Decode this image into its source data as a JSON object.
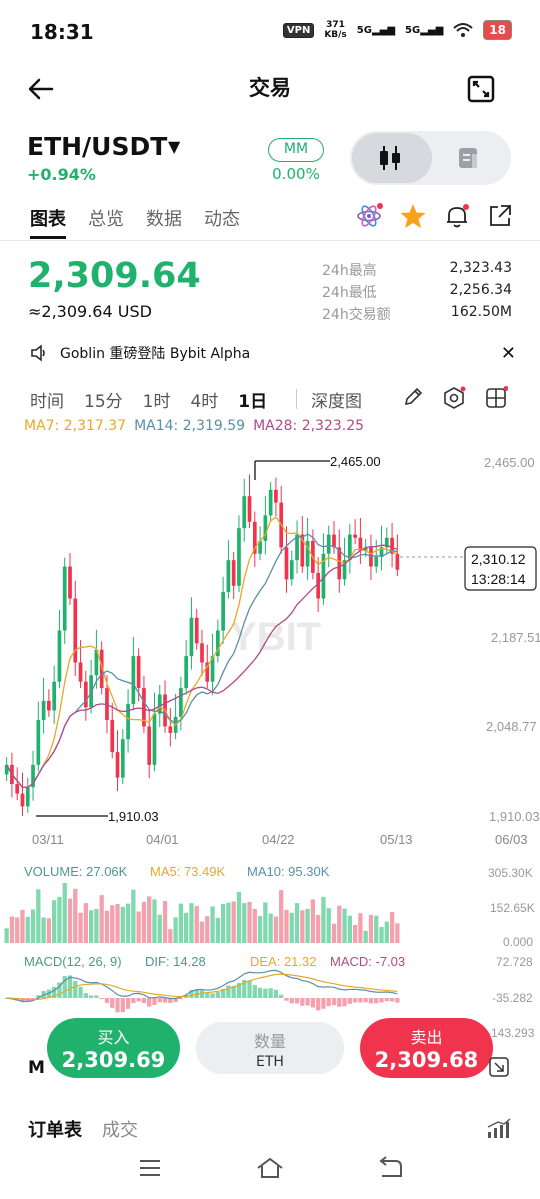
{
  "status_bar": {
    "time": "18:31",
    "vpn": "VPN",
    "speed_value": "371",
    "speed_unit": "KB/s",
    "net1": "5G",
    "net2": "5G",
    "battery": "18"
  },
  "header": {
    "title": "交易",
    "back_icon": "arrow-left-icon",
    "expand_icon": "expand-icon"
  },
  "pair": {
    "symbol": "ETH/USDT",
    "change": "+0.94%",
    "mm_label": "MM",
    "mm_value": "0.00%"
  },
  "tabs": [
    "图表",
    "总览",
    "数据",
    "动态"
  ],
  "ticker": {
    "price": "2,309.64",
    "price_usd": "≈2,309.64 USD",
    "stats": [
      {
        "label": "24h最高",
        "value": "2,323.43"
      },
      {
        "label": "24h最低",
        "value": "2,256.34"
      },
      {
        "label": "24h交易额",
        "value": "162.50M"
      }
    ]
  },
  "notice": {
    "text": "Goblin 重磅登陆 Bybit Alpha"
  },
  "intervals": {
    "items": [
      "时间",
      "15分",
      "1时",
      "4时",
      "1日"
    ],
    "active": "1日",
    "depth": "深度图"
  },
  "ma_legend": {
    "ma7": "MA7: 2,317.37",
    "ma14": "MA14: 2,319.59",
    "ma28": "MA28: 2,323.25"
  },
  "colors": {
    "up": "#20b26c",
    "down": "#f0344e",
    "ma7": "#e6a829",
    "ma14": "#5a8fa8",
    "ma28": "#b04a8a"
  },
  "chart_data": {
    "type": "candlestick",
    "y_axis_ticks": [
      "2,465.00",
      "2,187.51",
      "2,048.77",
      "1,910.03"
    ],
    "x_axis_ticks": [
      "03/11",
      "04/01",
      "04/22",
      "05/13",
      "06/03"
    ],
    "high_label": "2,465.00",
    "low_label": "1,910.03",
    "current_price": "2,310.12",
    "countdown": "13:28:14",
    "ylim": [
      1910.03,
      2465.0
    ],
    "closes": [
      1990,
      1960,
      1945,
      1925,
      1955,
      1990,
      2060,
      2090,
      2075,
      2120,
      2200,
      2300,
      2250,
      2150,
      2120,
      2080,
      2130,
      2170,
      2110,
      2060,
      2010,
      1970,
      2030,
      2085,
      2160,
      2110,
      2050,
      1990,
      2070,
      2100,
      2050,
      2040,
      2065,
      2110,
      2160,
      2220,
      2180,
      2150,
      2120,
      2160,
      2200,
      2260,
      2310,
      2270,
      2360,
      2410,
      2370,
      2320,
      2340,
      2380,
      2420,
      2400,
      2330,
      2280,
      2310,
      2350,
      2300,
      2340,
      2290,
      2250,
      2320,
      2350,
      2330,
      2280,
      2310,
      2350,
      2345,
      2325,
      2330,
      2300,
      2315,
      2330,
      2345,
      2320,
      2295
    ],
    "volume": {
      "title": "VOLUME: 27.06K",
      "ma5": "MA5: 73.49K",
      "ma10": "MA10: 95.30K",
      "ticks": [
        "305.30K",
        "152.65K",
        "0.000"
      ]
    },
    "macd": {
      "title": "MACD(12, 26, 9)",
      "dif": "DIF: 14.28",
      "dea": "DEA: 21.32",
      "macd": "MACD: -7.03",
      "ticks": [
        "72.728",
        "-35.282",
        "-143.293"
      ]
    }
  },
  "trade": {
    "buy_label": "买入",
    "buy_price": "2,309.69",
    "qty_label": "数量",
    "qty_unit": "ETH",
    "sell_label": "卖出",
    "sell_price": "2,309.68"
  },
  "orderbook": {
    "partial_label": "M",
    "tabs": [
      "订单表",
      "成交"
    ]
  }
}
